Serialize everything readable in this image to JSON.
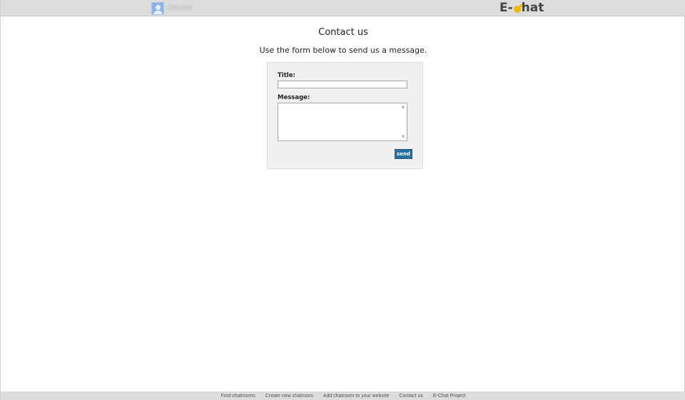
{
  "header": {
    "username": "Decolol",
    "logo": {
      "left": "E-",
      "right": "hat",
      "icon": "chat-bubble-icon"
    }
  },
  "main": {
    "heading": "Contact us",
    "subheading": "Use the form below to send us a message.",
    "form": {
      "title_label": "Title:",
      "title_value": "",
      "message_label": "Message:",
      "message_value": "",
      "send_label": "send"
    }
  },
  "footer": {
    "links": [
      "Find chatrooms",
      "Create new chatroom",
      "Add chatroom to your website",
      "Contact us",
      "E-Chat Project"
    ]
  },
  "colors": {
    "topbar_bg": "#dcdcdc",
    "form_bg": "#f0f0f0",
    "send_button": "#2a6fa3",
    "logo_accent": "#f2b705"
  }
}
